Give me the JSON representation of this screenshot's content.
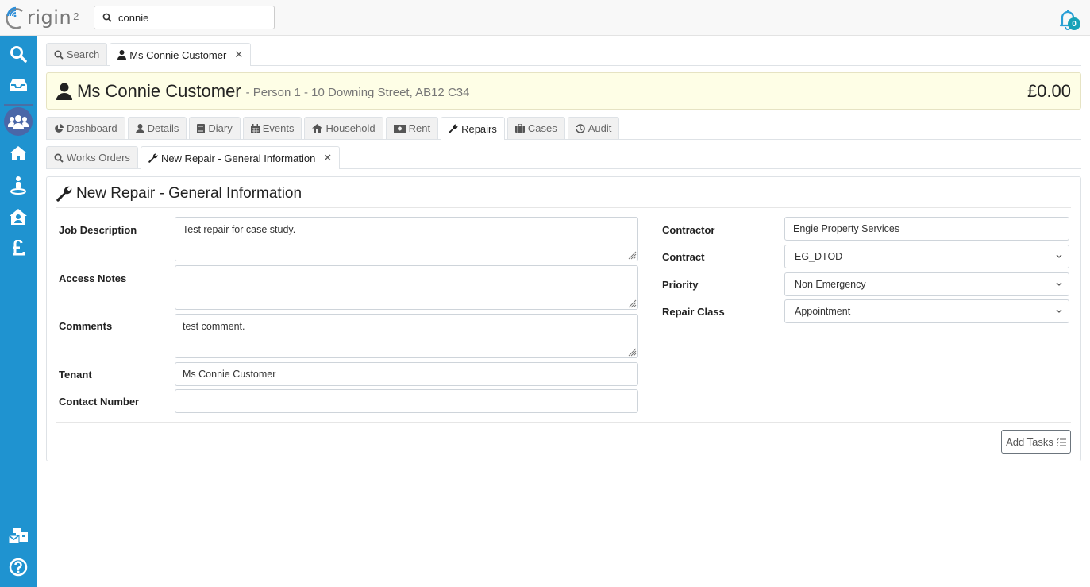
{
  "app": {
    "logo_text": "rigin",
    "logo_superscript": "2"
  },
  "search": {
    "value": "connie",
    "icon": "search-icon"
  },
  "notifications": {
    "count": "0",
    "icon": "bell-icon"
  },
  "sidebar": {
    "items": [
      {
        "name": "search",
        "icon": "search-icon"
      },
      {
        "name": "inbox",
        "icon": "inbox-icon"
      },
      {
        "name": "people",
        "icon": "users-icon",
        "active": true
      },
      {
        "name": "properties",
        "icon": "home-icon"
      },
      {
        "name": "person-location",
        "icon": "street-view-icon"
      },
      {
        "name": "house-user",
        "icon": "house-user-icon"
      },
      {
        "name": "finance",
        "icon": "pound-icon"
      },
      {
        "name": "communications",
        "icon": "mail-bulk-icon"
      },
      {
        "name": "help",
        "icon": "help-icon"
      }
    ]
  },
  "main_tabs": [
    {
      "label": "Search",
      "icon": "search-icon",
      "active": false
    },
    {
      "label": "Ms Connie Customer",
      "icon": "user-icon",
      "active": true,
      "closable": true
    }
  ],
  "person": {
    "name": "Ms Connie Customer",
    "subtitle": "- Person 1 - 10 Downing Street, AB12 C34",
    "balance": "£0.00"
  },
  "person_tabs": [
    {
      "label": "Dashboard",
      "icon": "chart-pie-icon"
    },
    {
      "label": "Details",
      "icon": "user-icon"
    },
    {
      "label": "Diary",
      "icon": "book-icon"
    },
    {
      "label": "Events",
      "icon": "calendar-icon"
    },
    {
      "label": "Household",
      "icon": "home-icon"
    },
    {
      "label": "Rent",
      "icon": "money-bill-icon"
    },
    {
      "label": "Repairs",
      "icon": "wrench-icon",
      "active": true
    },
    {
      "label": "Cases",
      "icon": "briefcase-icon"
    },
    {
      "label": "Audit",
      "icon": "history-icon"
    }
  ],
  "repair_tabs": [
    {
      "label": "Works Orders",
      "icon": "search-icon"
    },
    {
      "label": "New Repair - General Information",
      "icon": "wrench-icon",
      "active": true,
      "closable": true
    }
  ],
  "form": {
    "title": "New Repair - General Information",
    "left": {
      "job_description": {
        "label": "Job Description",
        "value": "Test repair for case study."
      },
      "access_notes": {
        "label": "Access Notes",
        "value": ""
      },
      "comments": {
        "label": "Comments",
        "value": "test comment."
      },
      "tenant": {
        "label": "Tenant",
        "value": "Ms Connie Customer"
      },
      "contact_number": {
        "label": "Contact Number",
        "value": ""
      }
    },
    "right": {
      "contractor": {
        "label": "Contractor",
        "value": "Engie Property Services"
      },
      "contract": {
        "label": "Contract",
        "value": "EG_DTOD"
      },
      "priority": {
        "label": "Priority",
        "value": "Non Emergency"
      },
      "repair_class": {
        "label": "Repair Class",
        "value": "Appointment"
      }
    },
    "add_tasks_label": "Add Tasks"
  },
  "colors": {
    "sidebar": "#1f93d0",
    "sidebar_active": "#4a67a8",
    "banner_bg": "#fefee6",
    "badge": "#17a2b8"
  }
}
